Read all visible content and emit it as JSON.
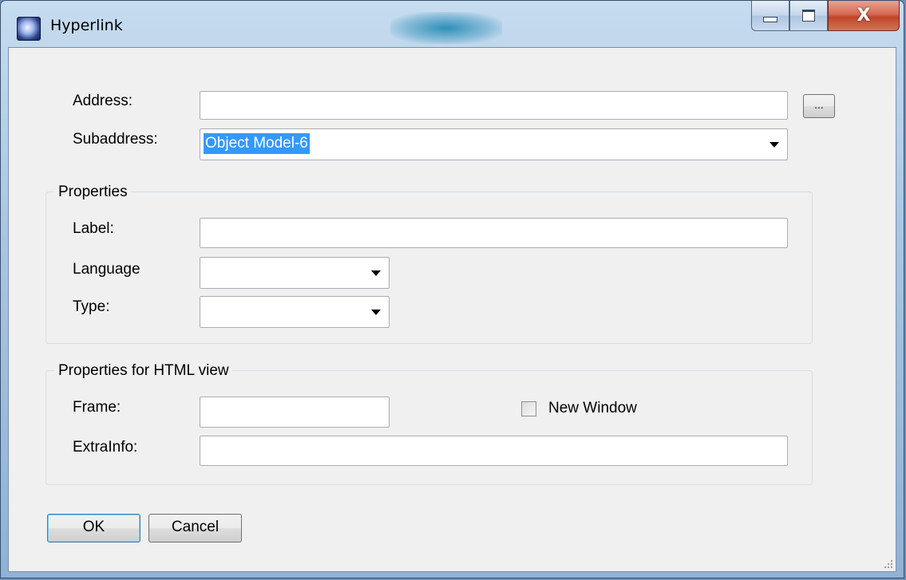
{
  "window": {
    "title": "Hyperlink",
    "icon": "hyperlink-app-icon",
    "close_glyph": "X"
  },
  "form": {
    "address_label": "Address:",
    "address_value": "",
    "browse_label": "...",
    "subaddress_label": "Subaddress:",
    "subaddress_value": "Object Model-6"
  },
  "properties": {
    "title": "Properties",
    "label_label": "Label:",
    "label_value": "",
    "language_label": "Language",
    "language_value": "",
    "type_label": "Type:",
    "type_value": ""
  },
  "html_view": {
    "title": "Properties for HTML view",
    "frame_label": "Frame:",
    "frame_value": "",
    "new_window_label": "New Window",
    "new_window_checked": false,
    "extrainfo_label": "ExtraInfo:",
    "extrainfo_value": ""
  },
  "buttons": {
    "ok_label": "OK",
    "cancel_label": "Cancel"
  }
}
